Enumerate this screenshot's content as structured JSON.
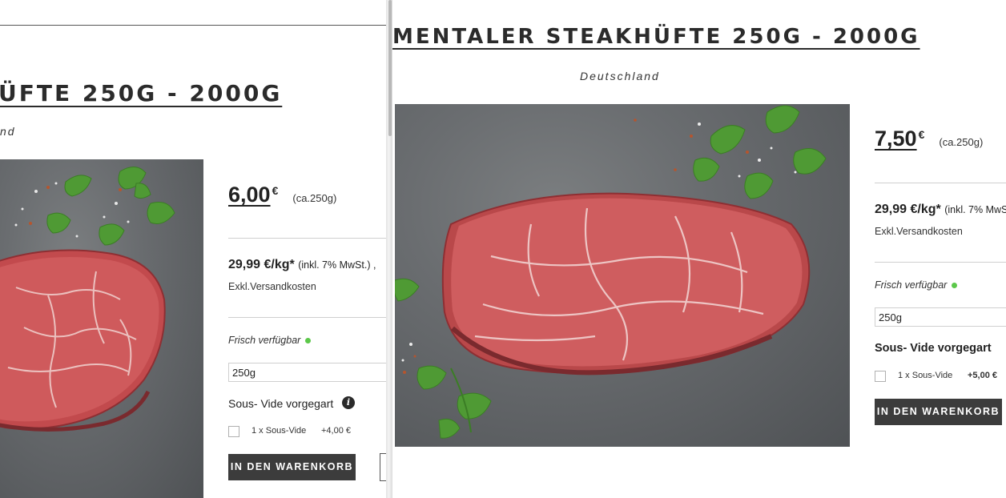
{
  "left_pane": {
    "title": "ÜFTE 250G - 2000G",
    "origin": "nd",
    "price": "6,00",
    "currency": "€",
    "weight": "(ca.250g)",
    "unit_price": "29,99 €/kg*",
    "tax_note": "(inkl. 7% MwSt.) ,",
    "shipping": "Exkl.Versandkosten",
    "availability": "Frisch verfügbar",
    "size_value": "250g",
    "sous_vide": "Sous- Vide vorgegart",
    "info_glyph": "i",
    "option_label": "1 x Sous-Vide",
    "option_price": "+4,00 €",
    "cart_button": "IN DEN WARENKORB"
  },
  "right_pane": {
    "title": "MENTALER STEAKHÜFTE 250G - 2000G",
    "origin": "Deutschland",
    "price": "7,50",
    "currency": "€",
    "weight": "(ca.250g)",
    "unit_price": "29,99 €/kg*",
    "tax_note": "(inkl. 7% MwS",
    "shipping": "Exkl.Versandkosten",
    "availability": "Frisch verfügbar",
    "size_value": "250g",
    "sous_vide": "Sous- Vide vorgegart",
    "option_label": "1 x Sous-Vide",
    "option_price": "+5,00 €",
    "cart_button": "IN DEN WARENKORB"
  },
  "colors": {
    "button_bg": "#3c3c3c",
    "availability_dot": "#5cc84a",
    "text": "#2a2a2a"
  },
  "icons": [
    "info-icon",
    "availability-dot-icon",
    "pane-divider"
  ]
}
